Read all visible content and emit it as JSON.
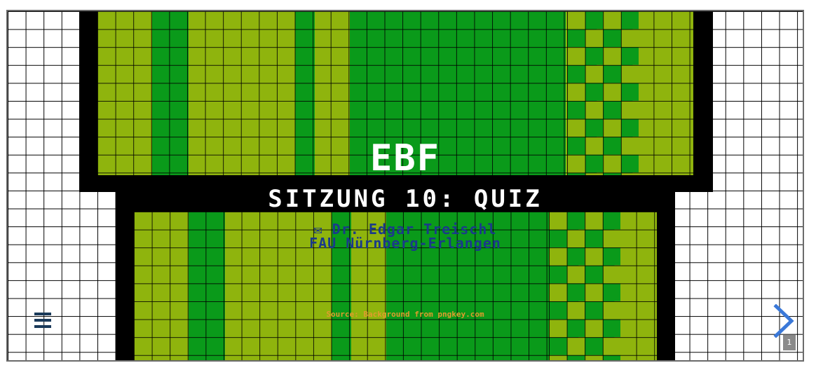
{
  "slide": {
    "title": "EBF",
    "subtitle": "SITZUNG 10: QUIZ",
    "author": "Dr. Edgar Treischl",
    "affiliation": "FAU Nürnberg-Erlangen",
    "author_icon": "envelope-icon",
    "author_icon_glyph": "✉",
    "source": "Source: Background from pngkey.com",
    "page_number": "1"
  },
  "controls": {
    "menu_icon": "hamburger-menu-icon",
    "next_icon": "chevron-right-icon"
  },
  "colors": {
    "light_green": "#8fb40d",
    "dark_green": "#0a9a1a",
    "title_text": "#ffffff",
    "author_text": "#1a3a8a",
    "source_text": "#e09b2d",
    "next_arrow": "#3a78d8",
    "menu_icon": "#1a3a5a"
  }
}
